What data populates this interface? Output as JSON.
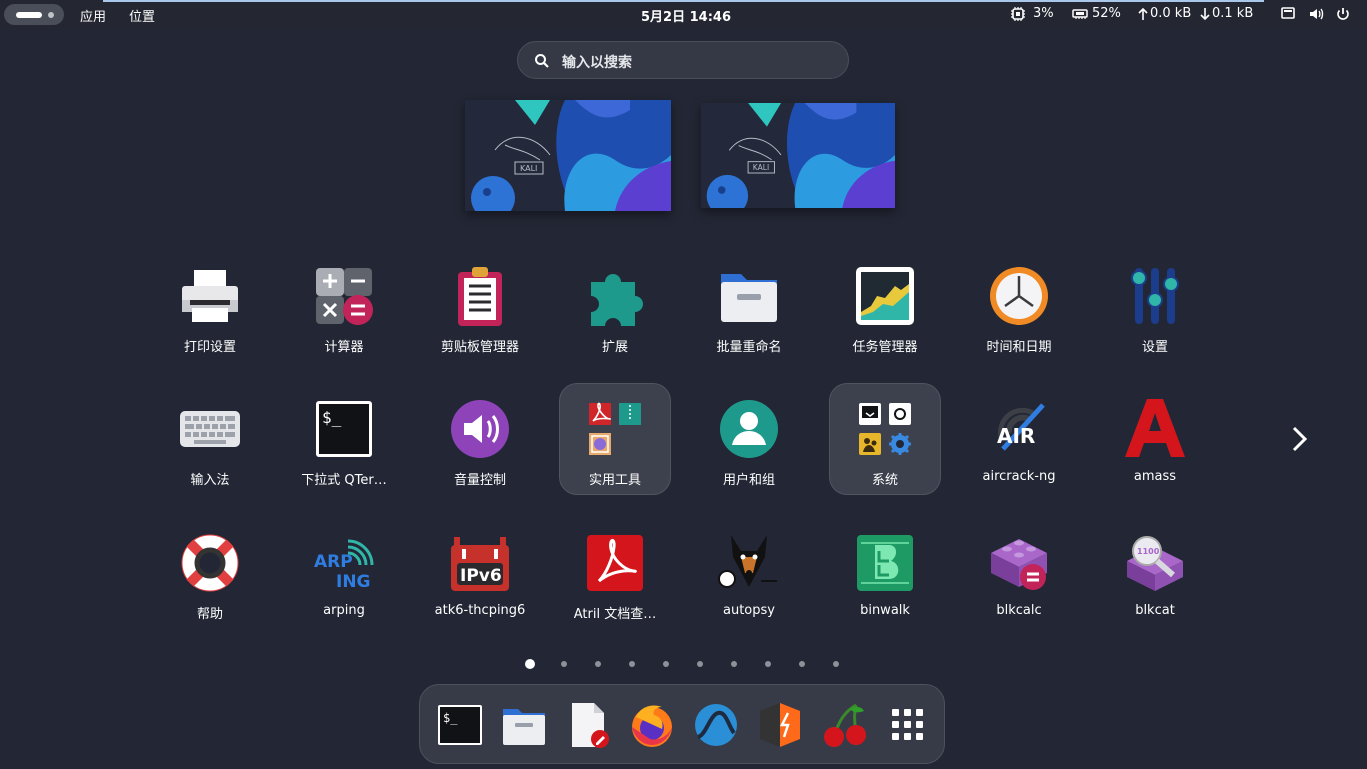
{
  "topbar": {
    "activities": "",
    "apps_menu": "应用",
    "places_menu": "位置",
    "clock": "5月2日  14:46",
    "cpu": "3%",
    "memory": "52%",
    "net_up": "0.0 kB",
    "net_down": "0.1 kB"
  },
  "search": {
    "placeholder": "输入以搜索"
  },
  "apps": {
    "row1": [
      "打印设置",
      "计算器",
      "剪贴板管理器",
      "扩展",
      "批量重命名",
      "任务管理器",
      "时间和日期",
      "设置"
    ],
    "row2": [
      "输入法",
      "下拉式 QTer…",
      "音量控制",
      "实用工具",
      "用户和组",
      "系统",
      "aircrack-ng",
      "amass"
    ],
    "row3": [
      "帮助",
      "arping",
      "atk6-thcping6",
      "Atril 文档查…",
      "autopsy",
      "binwalk",
      "blkcalc",
      "blkcat"
    ]
  },
  "icon_text": {
    "air": "AIR",
    "arp": "ARP",
    "ing": "ING",
    "ipv6": "IPv6",
    "kali": "KALI",
    "blkcat_badge": "1100"
  },
  "pages": {
    "count": 10,
    "current": 1
  },
  "colors": {
    "background": "#232735",
    "accent": "#a9c7ea",
    "folder": "#3d414d"
  }
}
